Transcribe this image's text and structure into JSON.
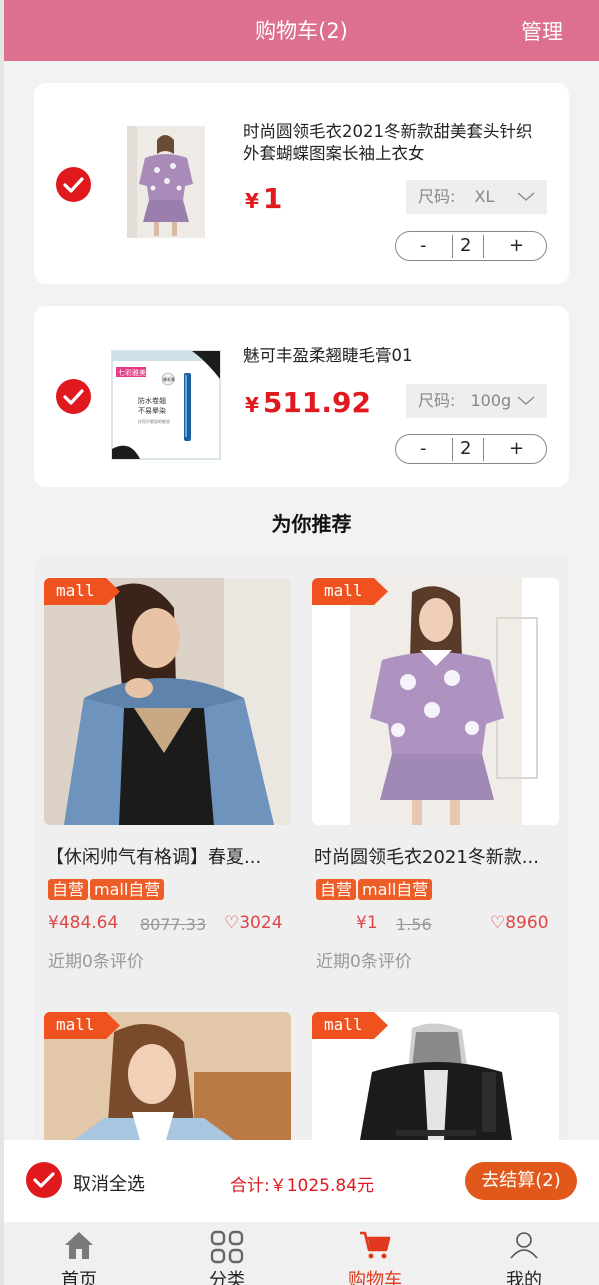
{
  "header": {
    "title": "购物车(2)",
    "manage": "管理"
  },
  "cart": {
    "items": [
      {
        "name": "时尚圆领毛衣2021冬新款甜美套头针织外套蝴蝶图案长袖上衣女",
        "currency": "¥",
        "price": "1",
        "size_label": "尺码:",
        "size_value": "XL",
        "quantity": "2",
        "minus": "-",
        "plus": "+",
        "checked": true
      },
      {
        "name": "魅可丰盈柔翘睫毛膏01",
        "currency": "¥",
        "price": "511.92",
        "size_label": "尺码:",
        "size_value": "100g",
        "quantity": "2",
        "minus": "-",
        "plus": "+",
        "checked": true,
        "image_text": {
          "brand": "七彩雅美",
          "badge": "睫毛膏",
          "line1": "防水卷翘",
          "line2": "不易晕染",
          "line3": "好用不脱妆的眼妆"
        }
      }
    ]
  },
  "recommend": {
    "title": "为你推荐",
    "items": [
      {
        "tag": "mall",
        "name": "【休闲帅气有格调】春夏...",
        "badges": [
          "自营",
          "mall自营"
        ],
        "price": "¥484.64",
        "old_price": "8077.33",
        "likes": "♡3024",
        "review": "近期0条评价"
      },
      {
        "tag": "mall",
        "name": "时尚圆领毛衣2021冬新款...",
        "badges": [
          "自营",
          "mall自营"
        ],
        "price": "¥1",
        "old_price": "1.56",
        "likes": "♡8960",
        "review": "近期0条评价"
      },
      {
        "tag": "mall"
      },
      {
        "tag": "mall"
      }
    ]
  },
  "footer": {
    "select_all": "取消全选",
    "total": "合计:￥1025.84元",
    "checkout": "去结算(2)"
  },
  "tabbar": [
    {
      "label": "首页",
      "icon": "home-icon"
    },
    {
      "label": "分类",
      "icon": "grid-icon"
    },
    {
      "label": "购物车",
      "icon": "cart-icon",
      "active": true
    },
    {
      "label": "我的",
      "icon": "user-icon"
    }
  ],
  "colors": {
    "header": "#dd6f8f",
    "accent_red": "#e0191f",
    "orange": "#e2581b",
    "mall_tag": "#f0521f"
  }
}
